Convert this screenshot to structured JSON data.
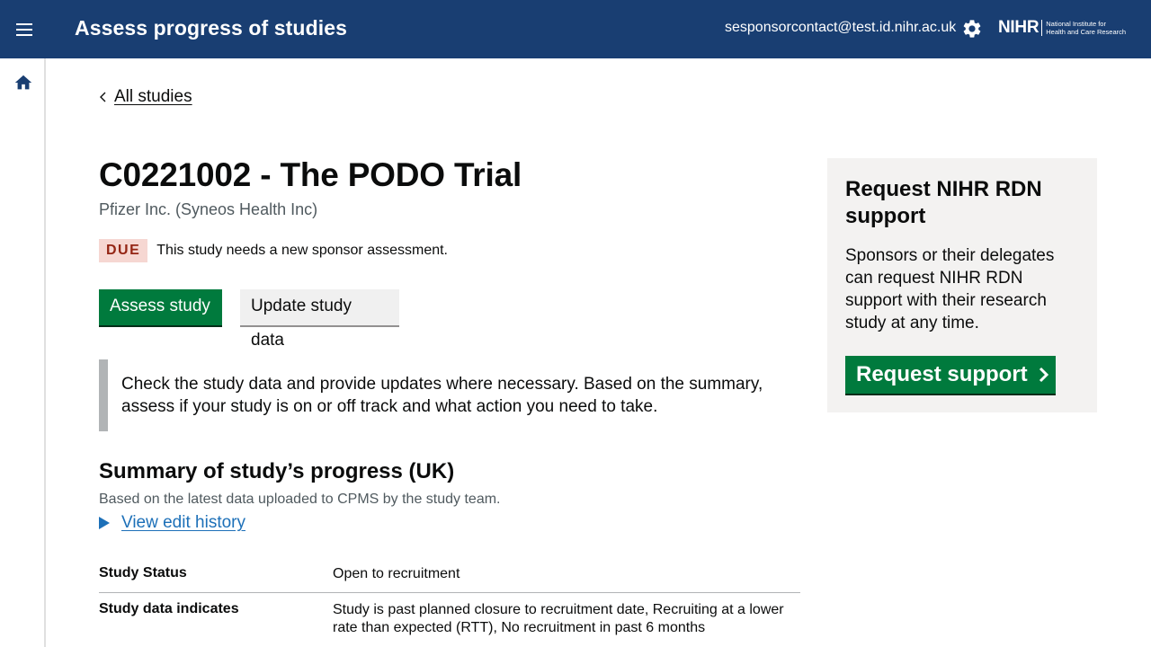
{
  "header": {
    "app_title": "Assess progress of studies",
    "user_email": "sesponsorcontact@test.id.nihr.ac.uk",
    "logo_main": "NIHR",
    "logo_sub_line1": "National Institute for",
    "logo_sub_line2": "Health and Care Research",
    "icons": [
      "menu-icon",
      "gear-icon"
    ]
  },
  "sidebar": {
    "icons": [
      "home-icon"
    ]
  },
  "main": {
    "back_link": "All studies",
    "study_title": "C0221002 - The PODO Trial",
    "sponsor": "Pfizer Inc. (Syneos Health Inc)",
    "status_tag": "DUE",
    "status_text": "This study needs a new sponsor assessment.",
    "primary_button": "Assess study",
    "secondary_button": "Update study data",
    "inset_text": "Check the study data and provide updates where necessary. Based on the summary, assess if your study is on or off track and what action you need to take.",
    "summary_heading": "Summary of study’s progress (UK)",
    "summary_subtext": "Based on the latest data uploaded to CPMS by the study team.",
    "details_link": "View edit history",
    "summary_rows": [
      {
        "key": "Study Status",
        "value": "Open to recruitment"
      },
      {
        "key": "Study data indicates",
        "value": "Study is past planned closure to recruitment date, Recruiting at a lower rate than expected (RTT), No recruitment in past 6 months"
      }
    ]
  },
  "panel": {
    "heading": "Request NIHR RDN support",
    "body": "Sponsors or their delegates can request NIHR RDN support with their research study at any time.",
    "button": "Request support"
  },
  "colors": {
    "header_bg": "#193e72",
    "primary_green": "#007a3d",
    "link_blue": "#1d70b8",
    "due_tag_bg": "#f6d7d2",
    "due_tag_text": "#942514"
  }
}
